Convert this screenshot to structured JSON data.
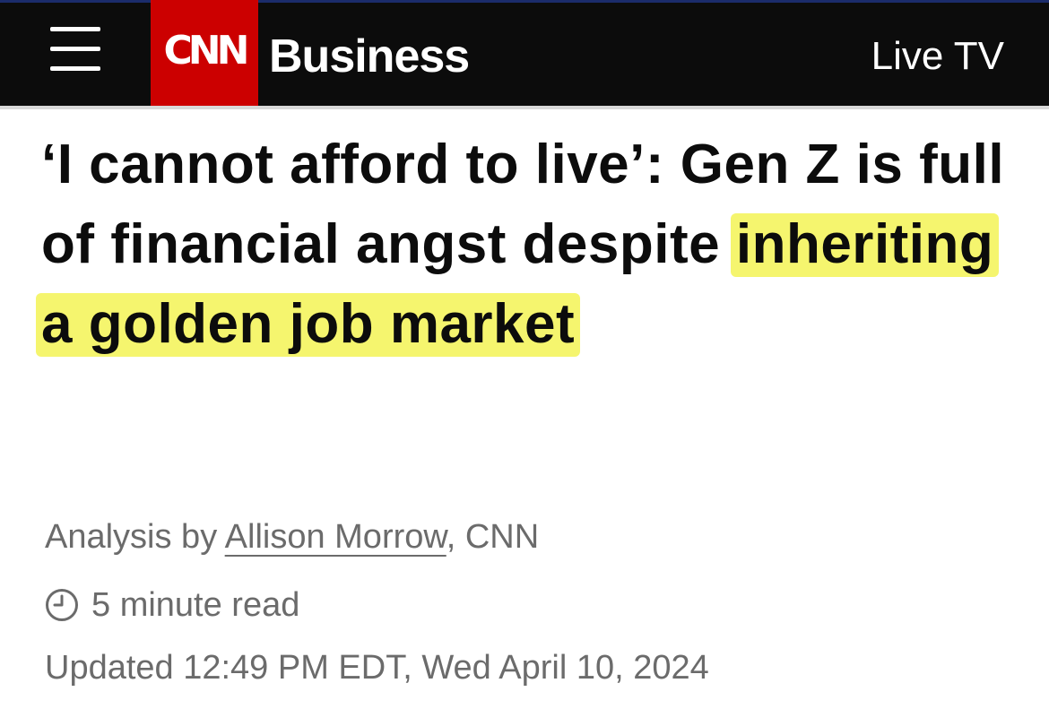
{
  "header": {
    "menu_icon": "hamburger-menu-icon",
    "logo_text": "CNN",
    "section": "Business",
    "live_tv": "Live TV",
    "background_color": "#0c0c0c",
    "logo_color": "#cc0000"
  },
  "article": {
    "headline_part1": "‘I cannot afford to live’: Gen Z is full of financial angst despite ",
    "headline_highlight": "inheriting a golden job market",
    "highlight_color": "#f5f56e",
    "byline": {
      "prefix": "Analysis by ",
      "author": "Allison Morrow",
      "suffix": ", CNN"
    },
    "read_time": {
      "icon": "clock-icon",
      "text": "5 minute read"
    },
    "updated": "Updated 12:49 PM EDT, Wed April 10, 2024"
  }
}
